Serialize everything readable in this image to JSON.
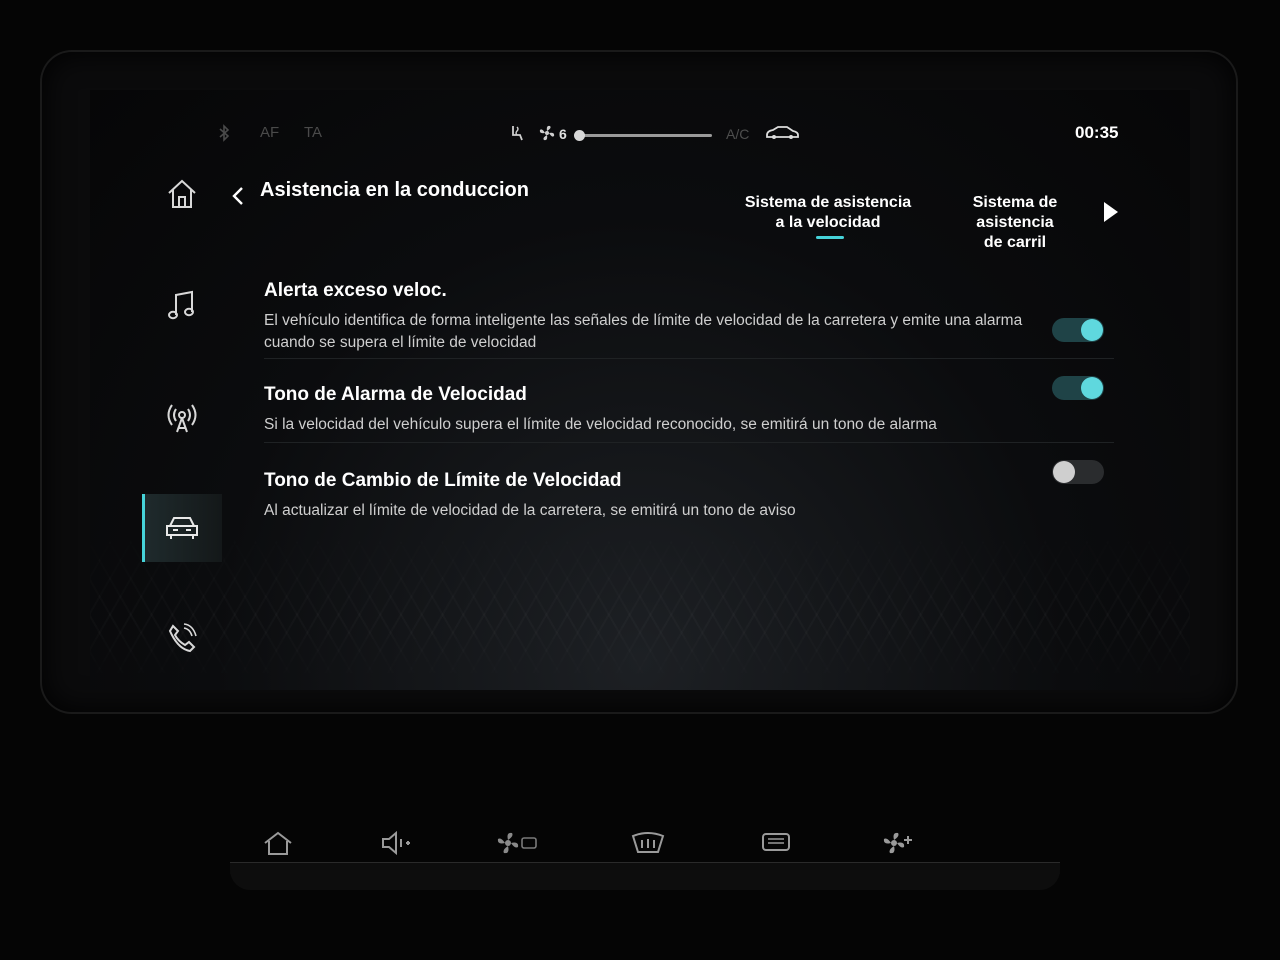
{
  "status": {
    "af": "AF",
    "ta": "TA",
    "fan_level": "6",
    "fan_fill": 0.02,
    "ac": "A/C",
    "clock": "00:35"
  },
  "nav": {
    "items": [
      {
        "icon": "home-icon"
      },
      {
        "icon": "music-note-icon"
      },
      {
        "icon": "radio-antenna-icon"
      },
      {
        "icon": "car-assist-icon",
        "active": true
      },
      {
        "icon": "phone-icon"
      }
    ]
  },
  "header": {
    "title": "Asistencia en la conduccion",
    "tabs": [
      {
        "line1": "Sistema de asistencia",
        "line2": "a la velocidad",
        "active": true
      },
      {
        "line1": "Sistema de asistencia",
        "line2": "de carril",
        "active": false
      }
    ]
  },
  "settings": [
    {
      "title": "Alerta exceso veloc.",
      "description": "El vehículo identifica de forma inteligente las señales de límite de velocidad de la carretera y emite una alarma cuando se supera el límite de velocidad",
      "enabled": true
    },
    {
      "title": "Tono de Alarma de Velocidad",
      "description": "Si la velocidad del vehículo supera el límite de velocidad reconocido, se emitirá un tono de alarma",
      "enabled": true
    },
    {
      "title": "Tono de Cambio de Límite de Velocidad",
      "description": "Al actualizar el límite de velocidad de la carretera, se emitirá un tono de aviso",
      "enabled": false
    }
  ],
  "colors": {
    "accent": "#46d3d9",
    "toggle_on": "#5fd8de",
    "background": "#050505"
  }
}
